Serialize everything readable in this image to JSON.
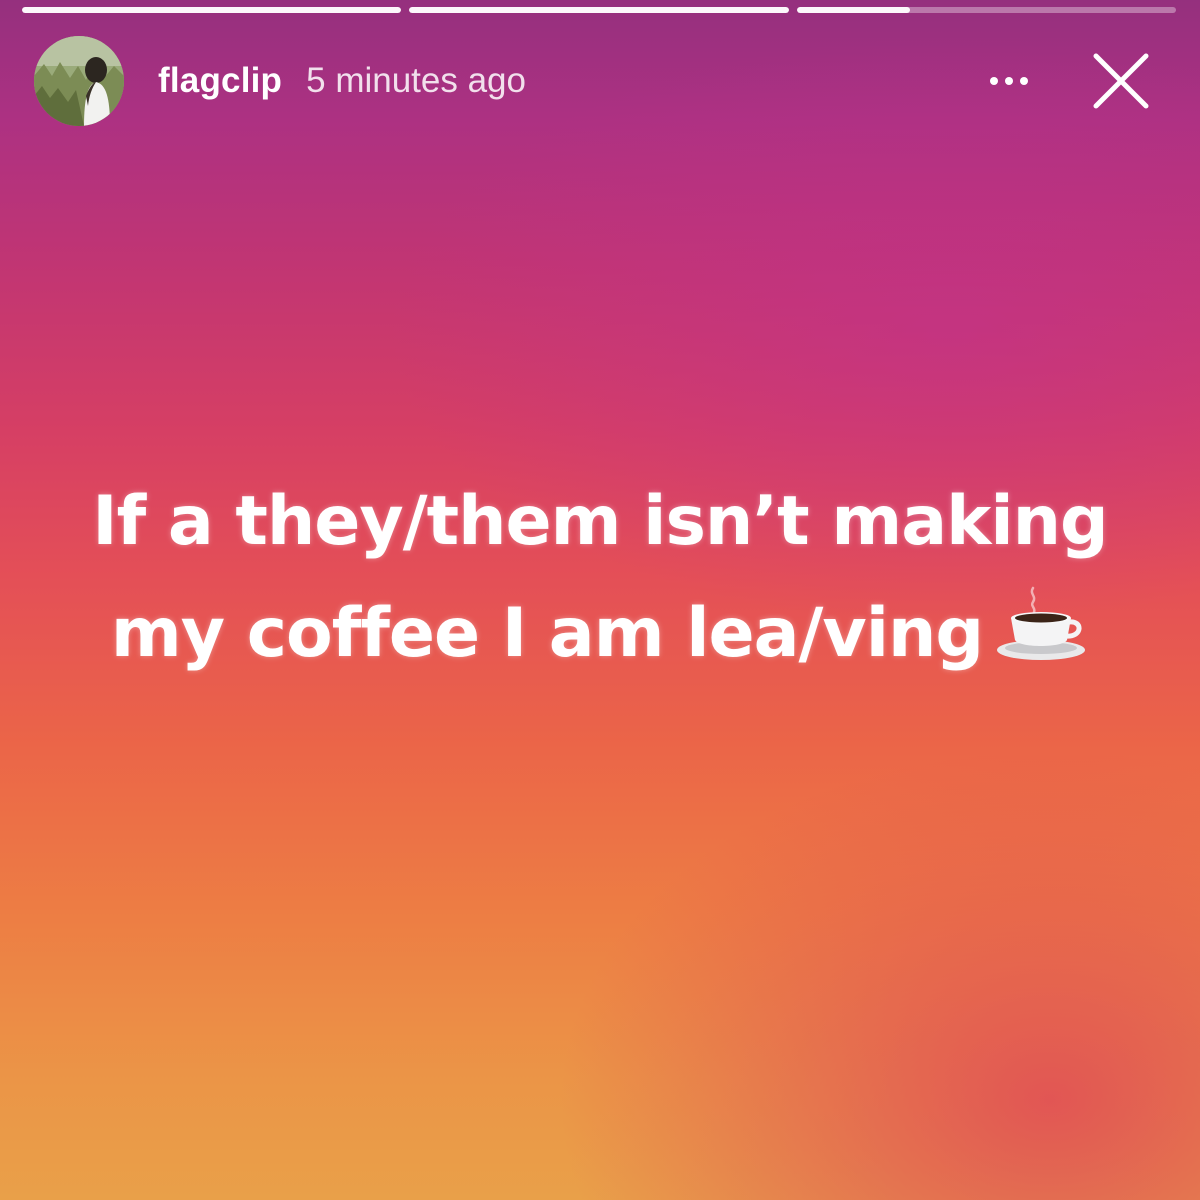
{
  "progress": {
    "segments": [
      {
        "fill": 1.0
      },
      {
        "fill": 1.0
      },
      {
        "fill": 0.3
      }
    ]
  },
  "header": {
    "username": "flagclip",
    "timestamp": "5 minutes ago",
    "more_icon": "more-horizontal-icon",
    "close_icon": "close-icon"
  },
  "story": {
    "line1": "If a they/them isn’t making",
    "line2": "my coffee I am lea/ving",
    "emoji_icon": "hot-beverage-icon"
  },
  "colors": {
    "gradient_top": "#95307e",
    "gradient_middle": "#e44f57",
    "gradient_bottom": "#e9a049",
    "text": "#ffffff"
  }
}
